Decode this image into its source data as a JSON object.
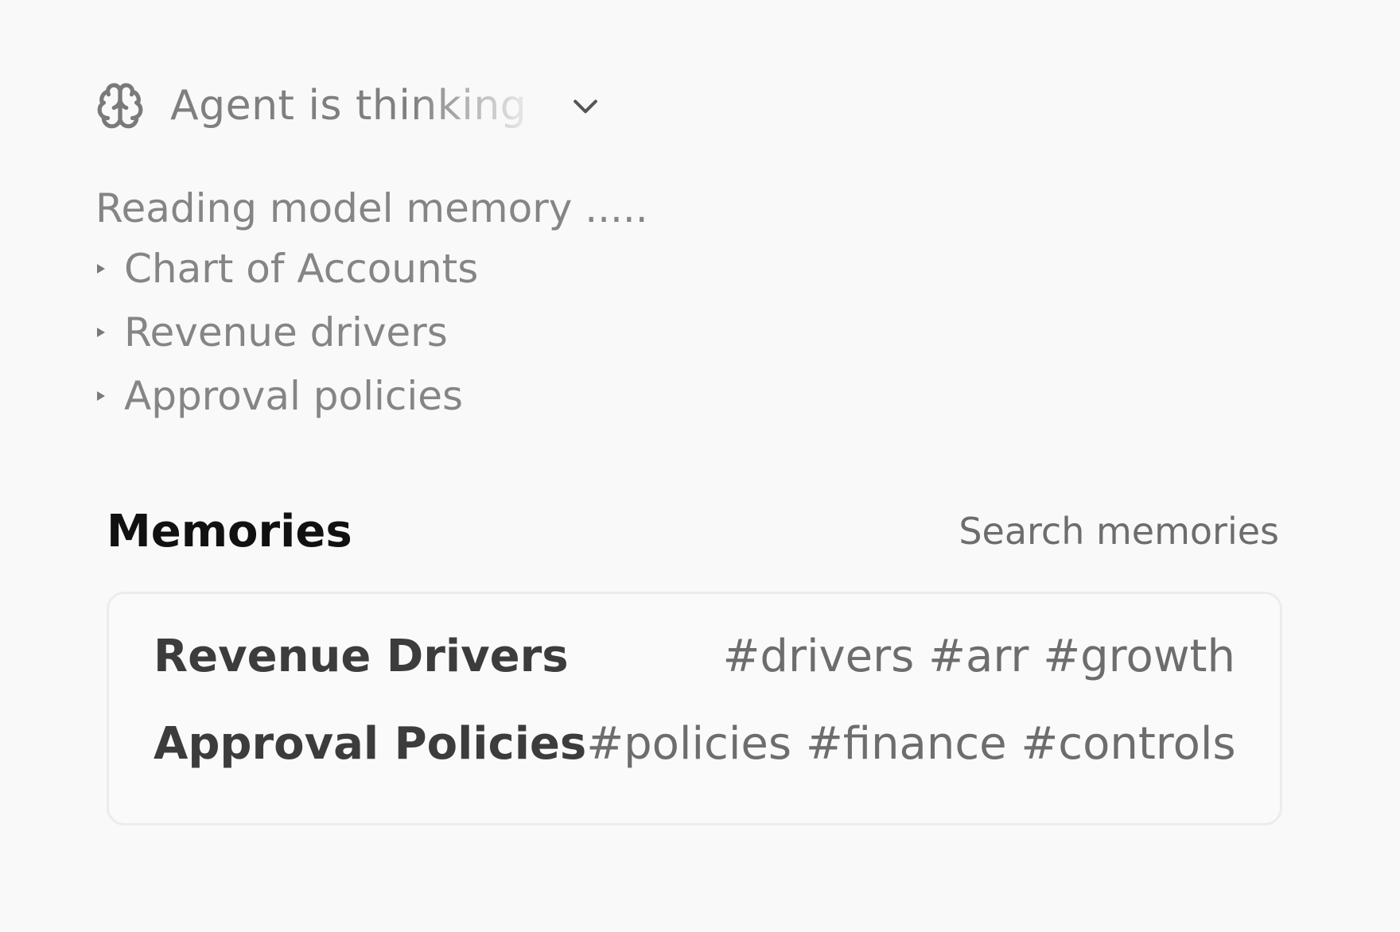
{
  "thinking": {
    "label": "Agent is thinking",
    "icon": "brain-icon",
    "toggle_icon": "chevron-down-icon"
  },
  "reading": {
    "status": "Reading model memory .....",
    "items": [
      {
        "label": "Chart of Accounts",
        "icon": "triangle-right-icon"
      },
      {
        "label": "Revenue drivers",
        "icon": "triangle-right-icon"
      },
      {
        "label": "Approval policies",
        "icon": "triangle-right-icon"
      }
    ]
  },
  "memories": {
    "title": "Memories",
    "search_label": "Search memories",
    "rows": [
      {
        "title": "Revenue Drivers",
        "tags": "#drivers #arr #growth"
      },
      {
        "title": "Approval Policies",
        "tags": "#policies #finance #controls"
      }
    ]
  },
  "colors": {
    "background": "#f9f9f9",
    "muted_text": "#858585",
    "heading_text": "#111111",
    "card_border": "#ececec"
  }
}
